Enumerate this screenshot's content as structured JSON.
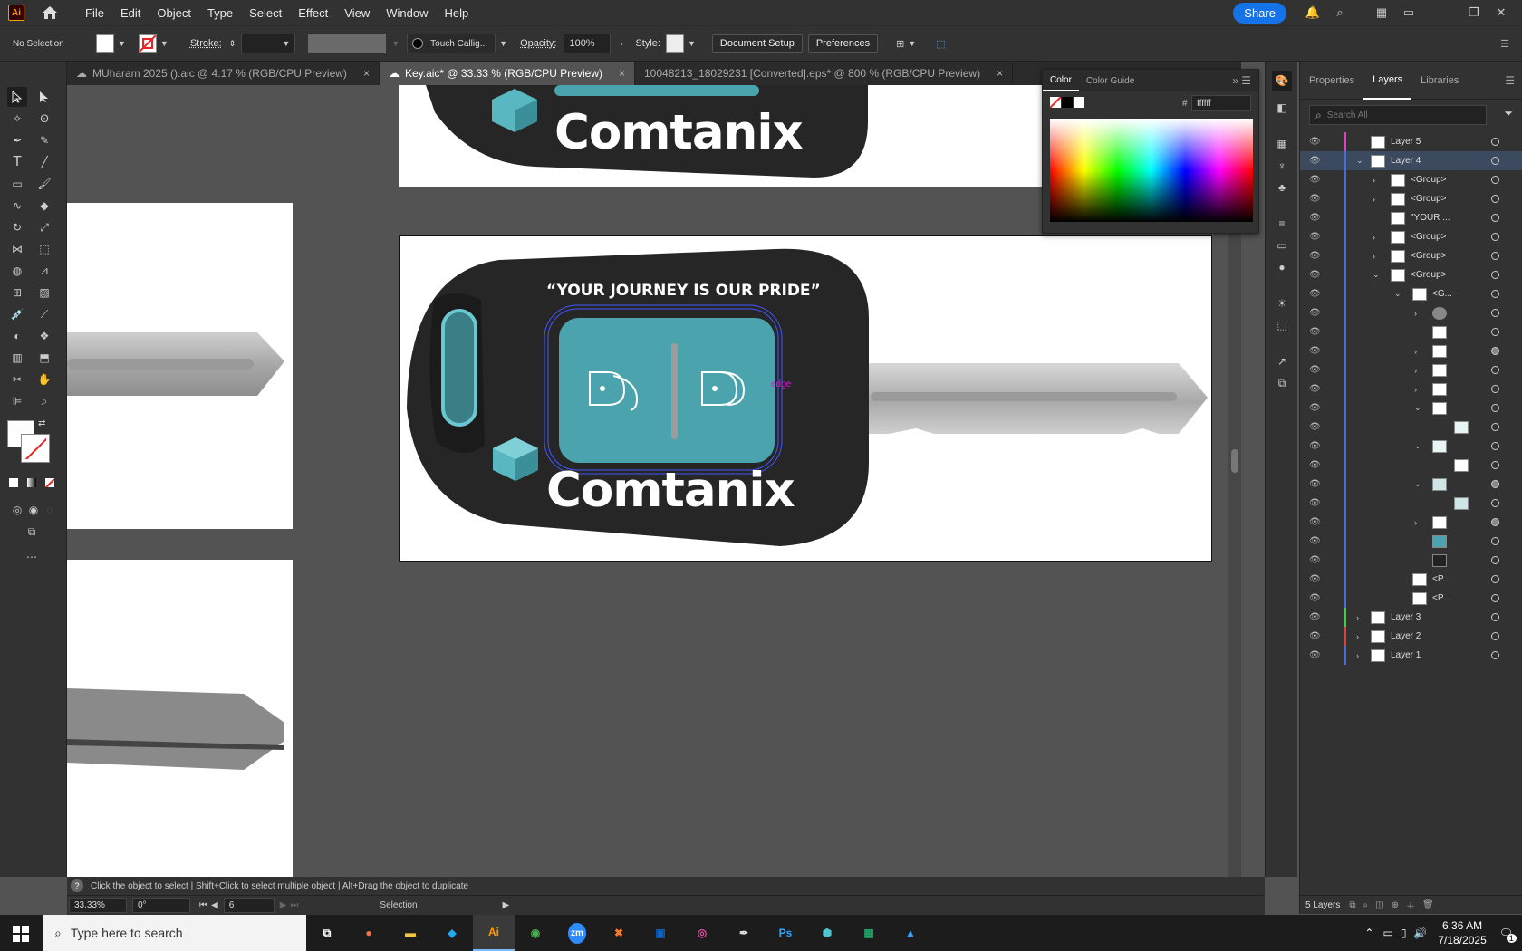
{
  "app": {
    "logo": "Ai",
    "menus": [
      "File",
      "Edit",
      "Object",
      "Type",
      "Select",
      "Effect",
      "View",
      "Window",
      "Help"
    ],
    "share_label": "Share"
  },
  "control": {
    "selection": "No Selection",
    "stroke_label": "Stroke:",
    "brush": "Touch Callig...",
    "opacity_label": "Opacity:",
    "opacity_value": "100%",
    "style_label": "Style:",
    "document_setup": "Document Setup",
    "preferences": "Preferences"
  },
  "tabs": [
    {
      "label": "MUharam 2025 ().aic @ 4.17 % (RGB/CPU Preview)",
      "close": "×"
    },
    {
      "label": "Key.aic* @ 33.33 % (RGB/CPU Preview)",
      "close": "×"
    },
    {
      "label": "10048213_18029231 [Converted].eps* @ 800 % (RGB/CPU Preview)",
      "close": "×"
    }
  ],
  "artwork": {
    "brand": "Comtanix",
    "slogan": "“YOUR JOURNEY IS OUR PRIDE”",
    "smart_guide": "edge",
    "colors": {
      "fob": "#262626",
      "teal": "#4aa3ad",
      "key_metal": "#b4b4b4"
    }
  },
  "color_panel": {
    "tabs": [
      "Color",
      "Color Guide"
    ],
    "hash": "#",
    "hex": "ffffff"
  },
  "right_panel": {
    "tabs": [
      "Properties",
      "Layers",
      "Libraries"
    ],
    "search_placeholder": "Search All",
    "layers": [
      {
        "name": "Layer 5",
        "color": "#e040c8"
      },
      {
        "name": "Layer 4",
        "color": "#4a6be0"
      },
      {
        "name": "<Group>"
      },
      {
        "name": "<Group>"
      },
      {
        "name": "\"YOUR ..."
      },
      {
        "name": "<Group>"
      },
      {
        "name": "<Group>"
      },
      {
        "name": "<Group>"
      },
      {
        "name": "<G..."
      },
      {
        "name": "<P..."
      },
      {
        "name": "<P..."
      },
      {
        "name": "Layer 3",
        "color": "#40d040"
      },
      {
        "name": "Layer 2",
        "color": "#e04040"
      },
      {
        "name": "Layer 1",
        "color": "#4a6be0"
      }
    ],
    "footer": "5 Layers"
  },
  "status": {
    "hint": "Click the object to select  |  Shift+Click to select multiple object  |  Alt+Drag the object to duplicate",
    "zoom": "33.33%",
    "rotation": "0°",
    "artboard_num": "6",
    "tool": "Selection"
  },
  "taskbar": {
    "search_placeholder": "Type here to search",
    "time": "6:36 AM",
    "date": "7/18/2025",
    "notif_count": "1"
  }
}
